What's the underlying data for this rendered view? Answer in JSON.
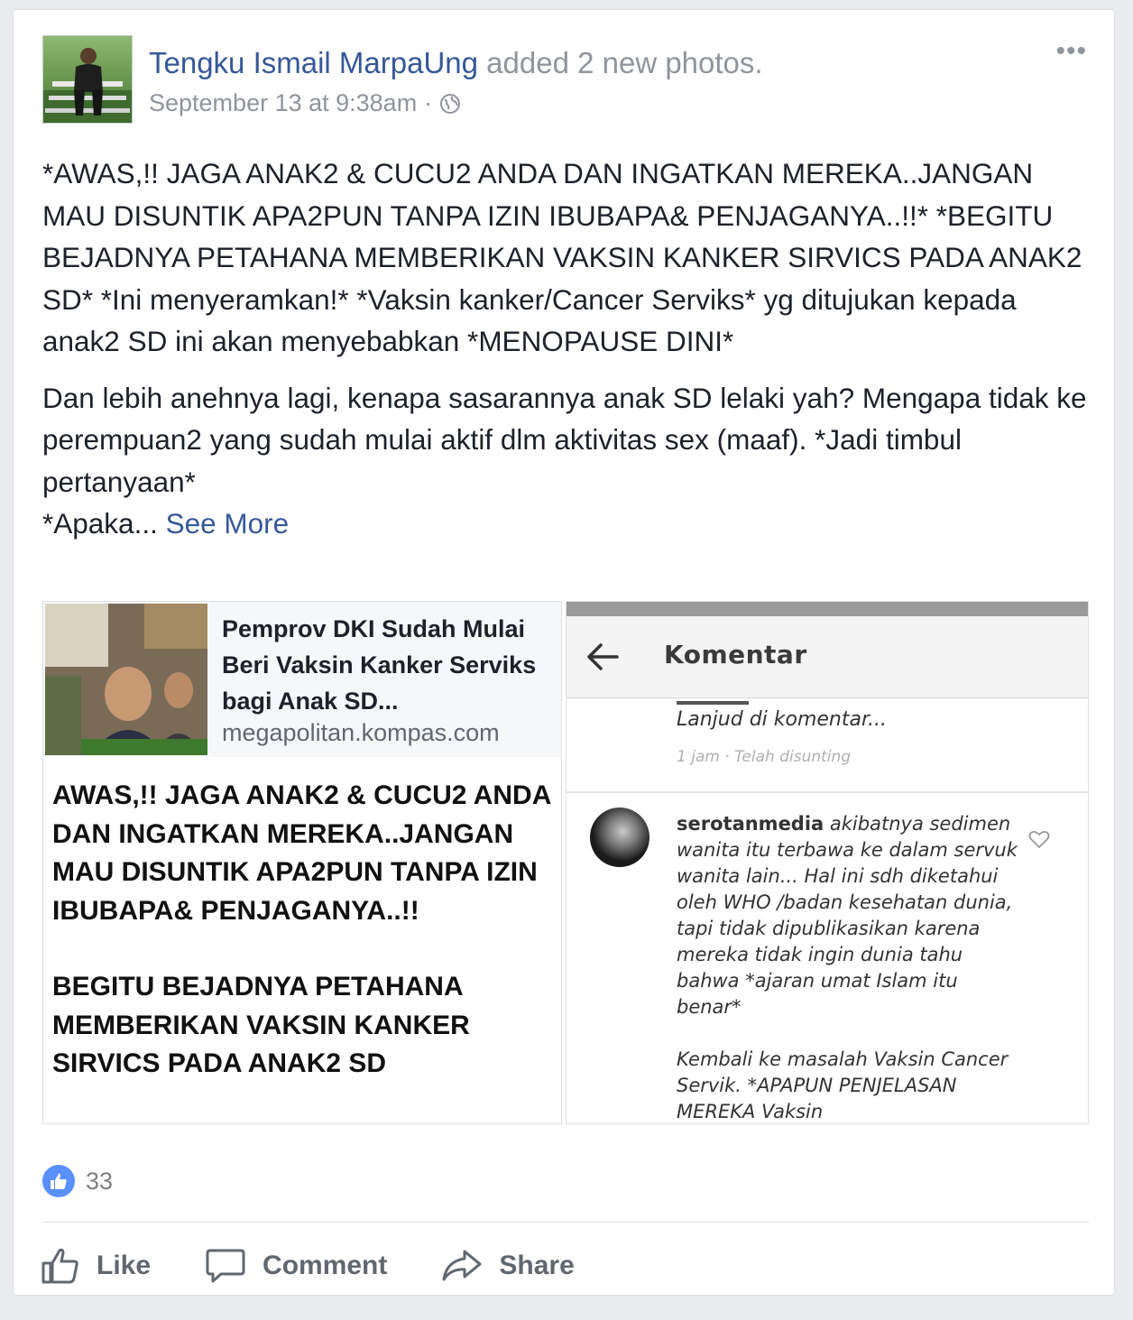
{
  "post": {
    "author_name": "Tengku Ismail MarpaUng",
    "action": "added 2 new photos.",
    "timestamp": "September 13 at 9:38am",
    "separator": "·",
    "audience_icon": "globe-icon",
    "more_label": "•••",
    "paragraph1": "*AWAS,!! JAGA ANAK2 & CUCU2 ANDA DAN INGATKAN MEREKA..JANGAN MAU DISUNTIK APA2PUN TANPA IZIN IBUBAPA& PENJAGANYA..!!* *BEGITU BEJADNYA PETAHANA MEMBERIKAN VAKSIN KANKER SIRVICS PADA ANAK2 SD* *Ini menyeramkan!* *Vaksin kanker/Cancer Serviks* yg ditujukan kepada anak2 SD ini akan menyebabkan *MENOPAUSE DINI*",
    "paragraph2": "Dan lebih anehnya lagi, kenapa sasarannya anak SD lelaki yah? Mengapa tidak ke perempuan2 yang sudah mulai aktif dlm aktivitas sex (maaf). *Jadi timbul pertanyaan*",
    "paragraph3_prefix": "*Apaka... ",
    "see_more": "See More"
  },
  "photo1": {
    "link_title": "Pemprov DKI Sudah Mulai Beri Vaksin Kanker Serviks bagi Anak SD...",
    "link_domain": "megapolitan.kompas.com",
    "text_block1": "AWAS,!!  JAGA ANAK2 & CUCU2 ANDA DAN INGATKAN MEREKA..JANGAN MAU DISUNTIK APA2PUN TANPA IZIN IBUBAPA& PENJAGANYA..!!",
    "text_block2": "BEGITU BEJADNYA PETAHANA MEMBERIKAN VAKSIN KANKER SIRVICS PADA ANAK2 SD"
  },
  "photo2": {
    "screen_title": "Komentar",
    "comment1_text": "Lanjud di komentar...",
    "comment1_meta": "1 jam · Telah disunting",
    "comment2_user": "serotanmedia",
    "comment2_text": "akibatnya sedimen wanita itu terbawa ke dalam servuk wanita lain... Hal ini sdh diketahui oleh WHO /badan kesehatan dunia, tapi tidak dipublikasikan karena mereka tidak ingin dunia tahu bahwa *ajaran umat Islam itu benar*",
    "comment2_text2": "Kembali ke masalah Vaksin Cancer Servik. *APAPUN PENJELASAN MEREKA Vaksin"
  },
  "reactions": {
    "count": "33",
    "icon": "like-reaction-icon"
  },
  "actions": {
    "like": "Like",
    "comment": "Comment",
    "share": "Share"
  },
  "colors": {
    "link": "#365899",
    "meta": "#90949c",
    "like_blue": "#5890ff"
  }
}
